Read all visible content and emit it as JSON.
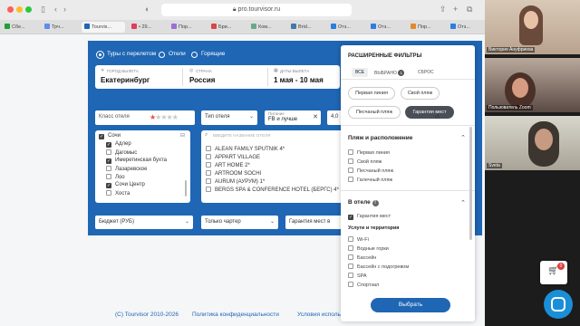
{
  "browser": {
    "url": "pro.tourvisor.ru",
    "tabs": [
      "Сбе...",
      "Трч...",
      "Tourvis...",
      "• 29...",
      "Пор...",
      "Бри...",
      "Ком...",
      "Brid...",
      "Отз...",
      "Отз...",
      "Пор...",
      "Отз..."
    ]
  },
  "search": {
    "tour_types": [
      "Туры с перелетом",
      "Отели",
      "Горящие"
    ],
    "depart_label": "ГОРОД ВЫЛЕТА",
    "depart_value": "Екатеринбург",
    "country_label": "СТРАНА",
    "country_value": "Россия",
    "dates_label": "ДАТЫ ВЫЛЕТА",
    "dates_value": "1 мая - 10 мая",
    "hotel_class_label": "Класс отеля",
    "hotel_type_label": "Тип отеля",
    "meal_label": "Питание",
    "meal_value": "FB и лучше",
    "rating_value": "4,0",
    "budget_label": "Бюджет (РУБ)",
    "charter_label": "Только чартер",
    "guarantee_label": "Гарантия мест в",
    "hotel_search_placeholder": "ВВЕДИТЕ НАЗВАНИЕ ОТЕЛЯ"
  },
  "regions": [
    {
      "label": "Сочи",
      "checked": true
    },
    {
      "label": "Адлер",
      "checked": true
    },
    {
      "label": "Дагомыс",
      "checked": false
    },
    {
      "label": "Имеретинская бухта",
      "checked": true
    },
    {
      "label": "Лазаревское",
      "checked": false
    },
    {
      "label": "Лоо",
      "checked": false
    },
    {
      "label": "Сочи Центр",
      "checked": true
    },
    {
      "label": "Хоста",
      "checked": false
    }
  ],
  "hotels": [
    "ALEAN FAMILY SPUTNIK 4*",
    "APPART VILLAGE",
    "ART HOME 2*",
    "ARTROOM SOCHI",
    "AURUM (АУРУМ) 1*",
    "BERGS SPA & CONFERENCE HOTEL (БЕРГС) 4*"
  ],
  "footer": {
    "copyright": "(C) Tourvisor 2010-2026",
    "privacy": "Политика конфиденциальности",
    "terms": "Условия использ"
  },
  "filters": {
    "title": "РАСШИРЕННЫЕ ФИЛЬТРЫ",
    "tab_all": "ВСЕ",
    "tab_selected": "ВЫБРАНО",
    "selected_count": "1",
    "tab_reset": "СБРОС",
    "chips": [
      "Первая линия",
      "Свой пляж",
      "Песчаный пляж",
      "Гарантия мест"
    ],
    "beach_section": "Пляж и расположение",
    "beach_items": [
      "Первая линия",
      "Свой пляж",
      "Песчаный пляж",
      "Галечный пляж"
    ],
    "hotel_section": "В отеле",
    "guarantee_item": "Гарантия мест",
    "services_heading": "Услуги и территория",
    "services_items": [
      "Wi-Fi",
      "Водные горки",
      "Бассейн",
      "Бассейн с подогревом",
      "SPA",
      "Спортзал"
    ],
    "apply": "Выбрать"
  },
  "video": {
    "participants": [
      "Виктория Ануфриева",
      "Пользователь Zoom",
      "Sveta"
    ]
  },
  "cart_count": "0",
  "colors": {
    "brand_blue": "#1f66b4",
    "chip_active": "#4a4f57"
  }
}
